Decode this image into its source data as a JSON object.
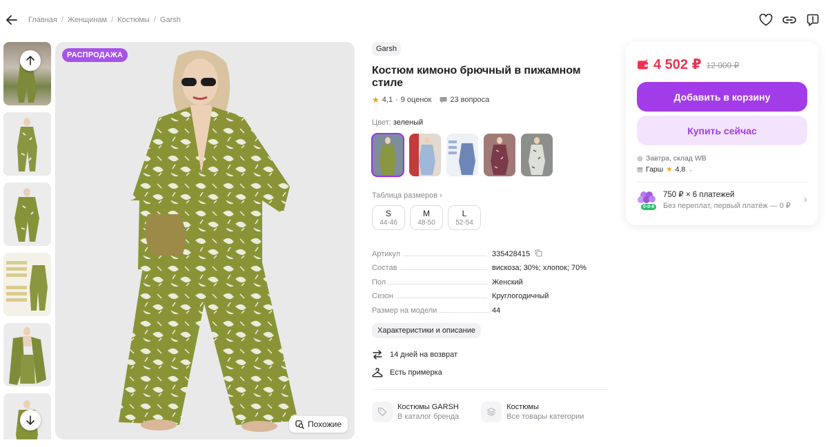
{
  "breadcrumbs": [
    "Главная",
    "Женщинам",
    "Костюмы",
    "Garsh"
  ],
  "gallery": {
    "sale_badge": "РАСПРОДАЖА",
    "similar_label": "Похожие",
    "accent_color": "#9c2ff0"
  },
  "product": {
    "brand": "Garsh",
    "title": "Костюм кимоно брючный в пижамном стиле",
    "rating": "4,1",
    "reviews": "9 оценок",
    "questions": "23 вопроса",
    "color_label": "Цвет:",
    "color_value": "зеленый",
    "size_table_link": "Таблица размеров",
    "sizes": [
      {
        "size": "S",
        "ru": "44-46"
      },
      {
        "size": "M",
        "ru": "48-50"
      },
      {
        "size": "L",
        "ru": "52-54"
      }
    ],
    "specs": [
      {
        "key": "Артикул",
        "value": "335428415"
      },
      {
        "key": "Состав",
        "value": "вискоза; 30%; хлопок; 70%"
      },
      {
        "key": "Пол",
        "value": "Женский"
      },
      {
        "key": "Сезон",
        "value": "Круглогодичный"
      },
      {
        "key": "Размер на модели",
        "value": "44"
      }
    ],
    "details_chip": "Характеристики и описание",
    "return_text": "14 дней на возврат",
    "fitting_text": "Есть примерка",
    "links": [
      {
        "title": "Костюмы GARSH",
        "subtitle": "В каталог бренда"
      },
      {
        "title": "Костюмы",
        "subtitle": "Все товары категории"
      }
    ]
  },
  "buy_card": {
    "price": "4 502 ₽",
    "old_price": "12 000 ₽",
    "add_to_cart": "Добавить в корзину",
    "buy_now": "Купить сейчас",
    "delivery": "Завтра, склад WB",
    "seller": "Гарш",
    "seller_rating": "4,8",
    "installment_title": "750 ₽ × 6 платежей",
    "installment_sub": "Без переплат, первый платёж — 0 ₽",
    "installment_badge": "0-0-6",
    "price_color": "#f2304f",
    "button_color": "#a23ce8"
  }
}
